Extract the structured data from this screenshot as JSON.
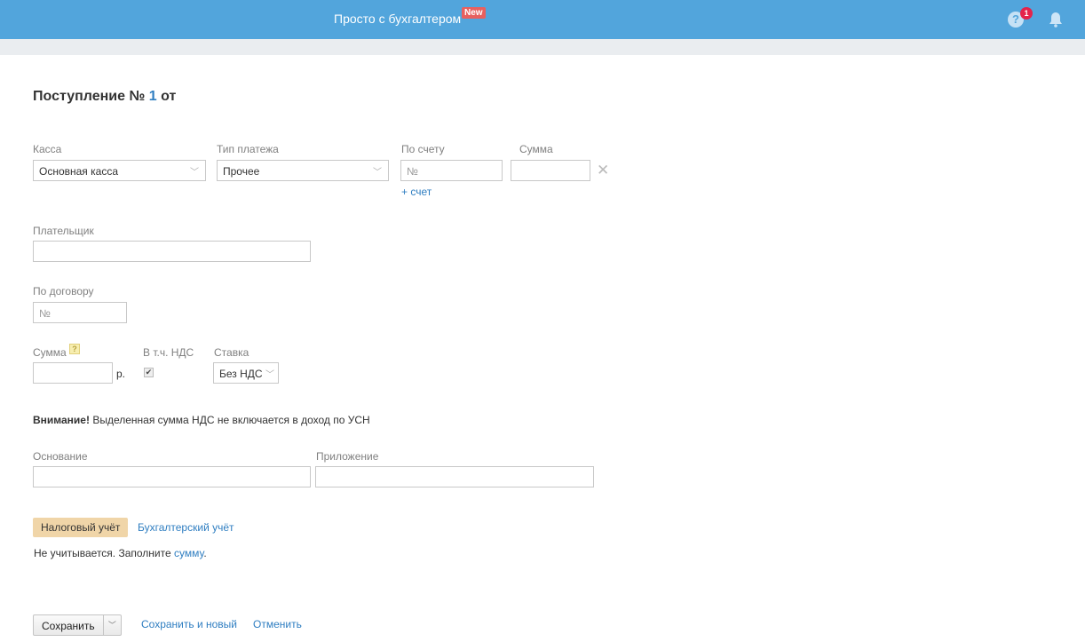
{
  "header": {
    "title": "Просто с бухгалтером",
    "badge": "New",
    "help_count": "1"
  },
  "page": {
    "title_prefix": "Поступление №",
    "number": "1",
    "title_suffix": "от"
  },
  "form": {
    "kassa": {
      "label": "Касса",
      "value": "Основная касса"
    },
    "payment_type": {
      "label": "Тип платежа",
      "value": "Прочее"
    },
    "invoice": {
      "label": "По счету",
      "placeholder": "№",
      "add_link": "+ счет"
    },
    "invoice_sum": {
      "label": "Сумма",
      "value": ""
    },
    "payer": {
      "label": "Плательщик",
      "value": ""
    },
    "contract": {
      "label": "По договору",
      "placeholder": "№"
    },
    "sum": {
      "label": "Сумма",
      "help": "?",
      "value": "",
      "unit": "р."
    },
    "vat_incl": {
      "label": "В т.ч. НДС",
      "checked": true
    },
    "rate": {
      "label": "Ставка",
      "value": "Без НДС"
    },
    "warning": {
      "bold": "Внимание!",
      "text": " Выделенная сумма НДС не включается в доход по УСН"
    },
    "basis": {
      "label": "Основание",
      "value": ""
    },
    "attachment": {
      "label": "Приложение",
      "value": ""
    }
  },
  "tabs": [
    {
      "label": "Налоговый учёт",
      "active": true
    },
    {
      "label": "Бухгалтерский учёт",
      "active": false
    }
  ],
  "tax_note": {
    "text": "Не учитывается. Заполните ",
    "link": "сумму",
    "end": "."
  },
  "actions": {
    "save": "Сохранить",
    "save_new": "Сохранить и новый",
    "cancel": "Отменить"
  }
}
